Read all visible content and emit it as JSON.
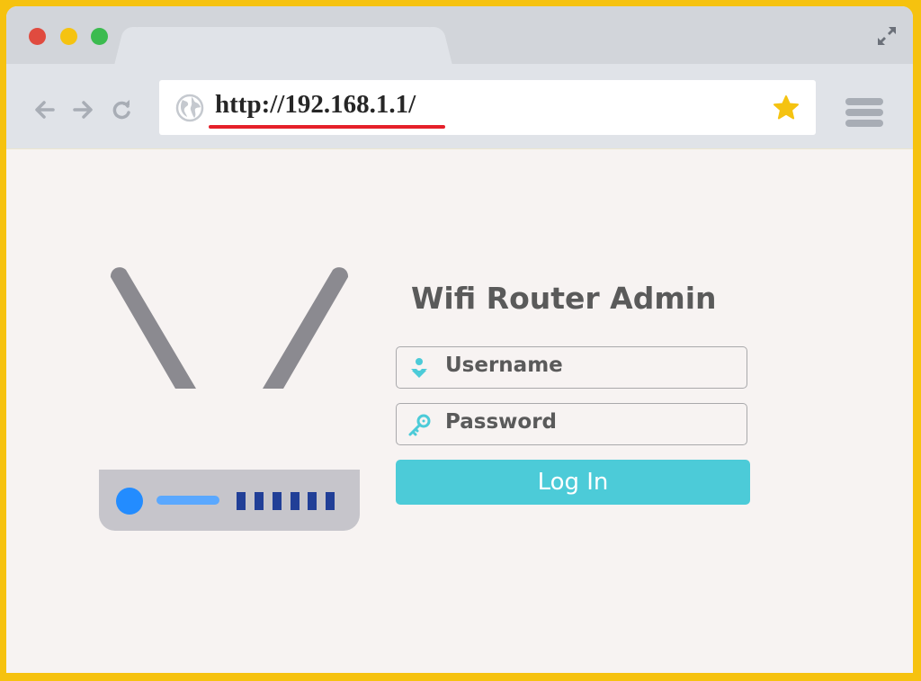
{
  "browser": {
    "window_controls": [
      "close",
      "minimize",
      "maximize"
    ],
    "expand_icon": "expand-arrows-icon",
    "nav": {
      "back": "arrow-left-icon",
      "forward": "arrow-right-icon",
      "reload": "reload-icon"
    },
    "address_bar": {
      "url": "http://192.168.1.1/",
      "site_icon": "globe-icon",
      "bookmark_icon": "star-icon"
    },
    "menu_icon": "hamburger-menu-icon"
  },
  "colors": {
    "frame": "#f6c20f",
    "accent": "#4ccbd8",
    "url_underline": "#e5202a",
    "title_text": "#5a5a5a"
  },
  "page": {
    "illustration": "wifi-router-illustration",
    "title": "Wifi Router Admin",
    "username": {
      "placeholder": "Username",
      "icon": "user-icon"
    },
    "password": {
      "placeholder": "Password",
      "icon": "key-icon"
    },
    "login_label": "Log In"
  }
}
